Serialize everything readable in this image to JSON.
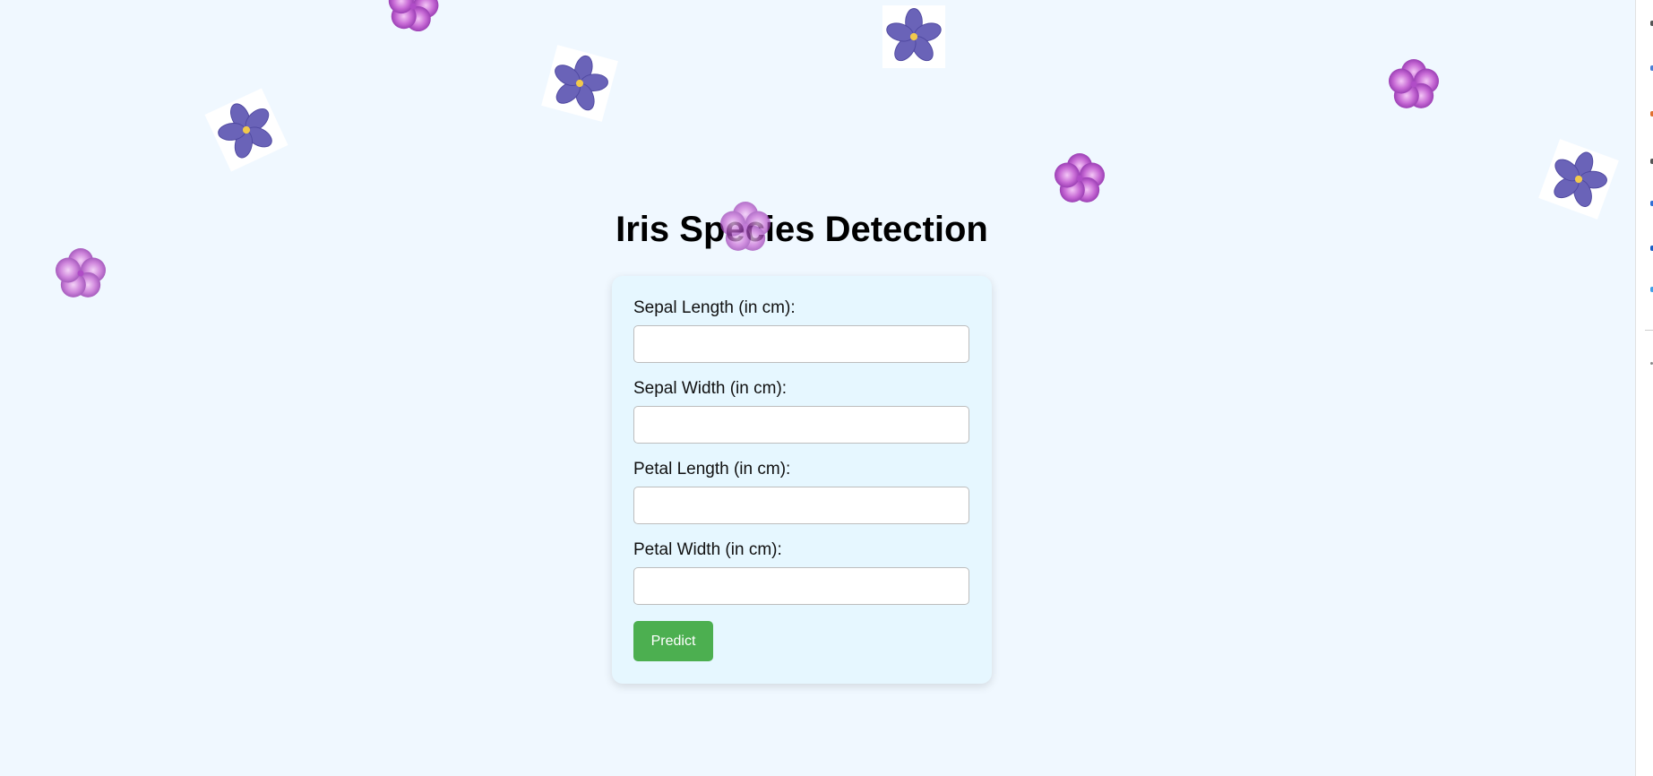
{
  "page": {
    "title": "Iris Species Detection"
  },
  "form": {
    "fields": [
      {
        "label": "Sepal Length (in cm):",
        "value": "",
        "placeholder": ""
      },
      {
        "label": "Sepal Width (in cm):",
        "value": "",
        "placeholder": ""
      },
      {
        "label": "Petal Length (in cm):",
        "value": "",
        "placeholder": ""
      },
      {
        "label": "Petal Width (in cm):",
        "value": "",
        "placeholder": ""
      }
    ],
    "submit_label": "Predict"
  },
  "decorations": {
    "flower_icons": [
      "violet-flower-icon",
      "pink-flower-icon"
    ]
  },
  "colors": {
    "background": "#f0f8ff",
    "card": "#e6f7ff",
    "button": "#4caf50",
    "violet_flower": "#6a63b8",
    "pink_flower": "#c86bd6"
  }
}
